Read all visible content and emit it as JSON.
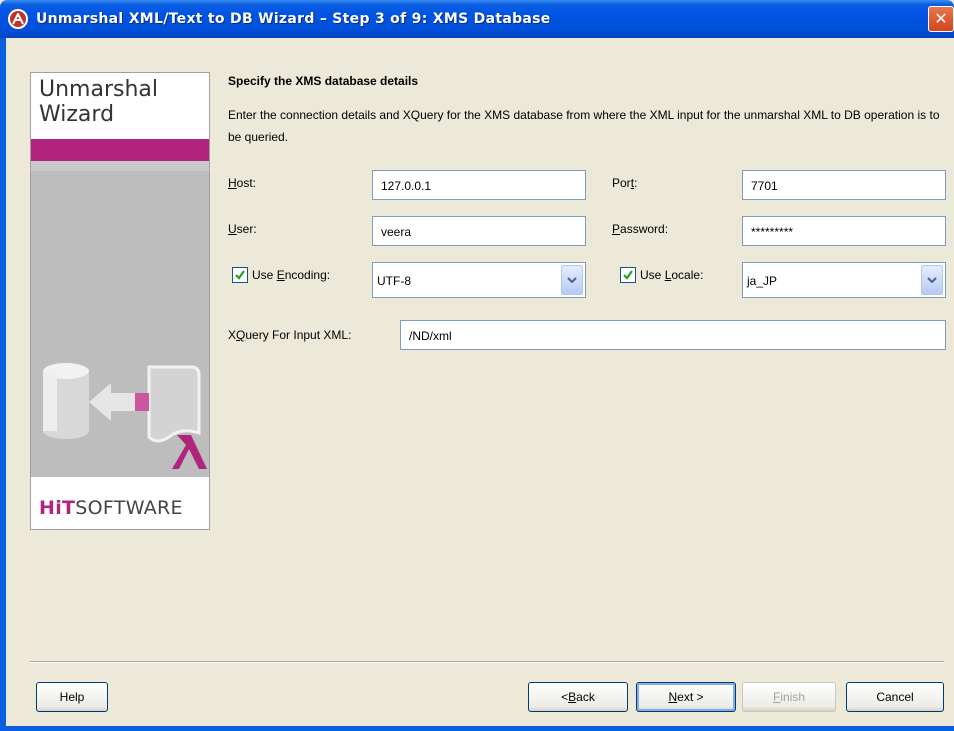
{
  "window": {
    "title": "Unmarshal XML/Text to DB Wizard – Step 3 of 9: XMS Database",
    "close_label": "✕"
  },
  "side": {
    "heading": "Unmarshal\nWizard",
    "logo_bold": "HiT",
    "logo_rest": "SOFTWARE"
  },
  "content": {
    "heading": "Specify the XMS database details",
    "description": "Enter the connection details and XQuery for the XMS database from where the XML input for the unmarshal XML to DB operation is to be queried."
  },
  "form": {
    "host_label_u": "H",
    "host_label_rest": "ost:",
    "host_value": "127.0.0.1",
    "port_label_pre": "Por",
    "port_label_u": "t",
    "port_label_post": ":",
    "port_value": "7701",
    "user_label_u": "U",
    "user_label_rest": "ser:",
    "user_value": "veera",
    "password_label_u": "P",
    "password_label_rest": "assword:",
    "password_value": "*********",
    "encoding_label_pre": "Use ",
    "encoding_label_u": "E",
    "encoding_label_post": "ncoding:",
    "encoding_value": "UTF-8",
    "encoding_checked": true,
    "locale_label_pre": "Use ",
    "locale_label_u": "L",
    "locale_label_post": "ocale:",
    "locale_value": "ja_JP",
    "locale_checked": true,
    "xquery_label_pre": "X",
    "xquery_label_u": "Q",
    "xquery_label_post": "uery For Input XML:",
    "xquery_value": "/ND/xml"
  },
  "buttons": {
    "help": "Help",
    "back_pre": "< ",
    "back_u": "B",
    "back_post": "ack",
    "next_u": "N",
    "next_post": "ext >",
    "finish_u": "F",
    "finish_post": "inish",
    "cancel": "Cancel"
  },
  "colors": {
    "accent": "#b0247e",
    "titlebar": "#0054e3"
  }
}
